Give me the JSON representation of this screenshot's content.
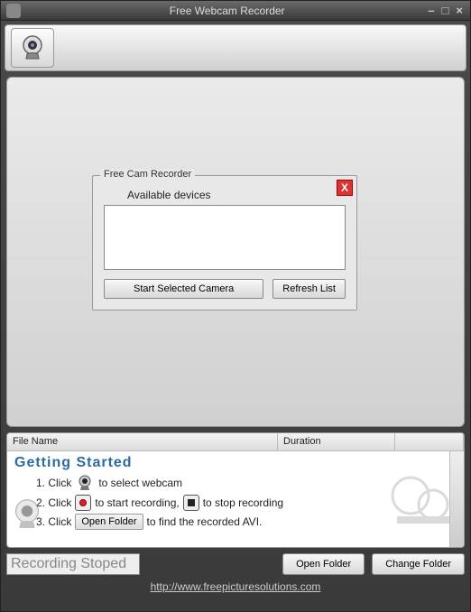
{
  "window": {
    "title": "Free Webcam Recorder"
  },
  "modal": {
    "legend": "Free Cam Recorder",
    "label": "Available devices",
    "start_btn": "Start Selected Camera",
    "refresh_btn": "Refresh List"
  },
  "list": {
    "col_file": "File Name",
    "col_duration": "Duration"
  },
  "getting_started": {
    "title": "Getting  Started",
    "line1_a": "1. Click",
    "line1_b": "to select webcam",
    "line2_a": "2. Click",
    "line2_b": "to start recording,",
    "line2_c": "to stop recording",
    "line3_a": "3. Click",
    "line3_btn": "Open Folder",
    "line3_b": "to find the recorded AVI."
  },
  "status": "Recording Stoped",
  "buttons": {
    "open_folder": "Open Folder",
    "change_folder": "Change Folder"
  },
  "footer_url": "http://www.freepicturesolutions.com"
}
